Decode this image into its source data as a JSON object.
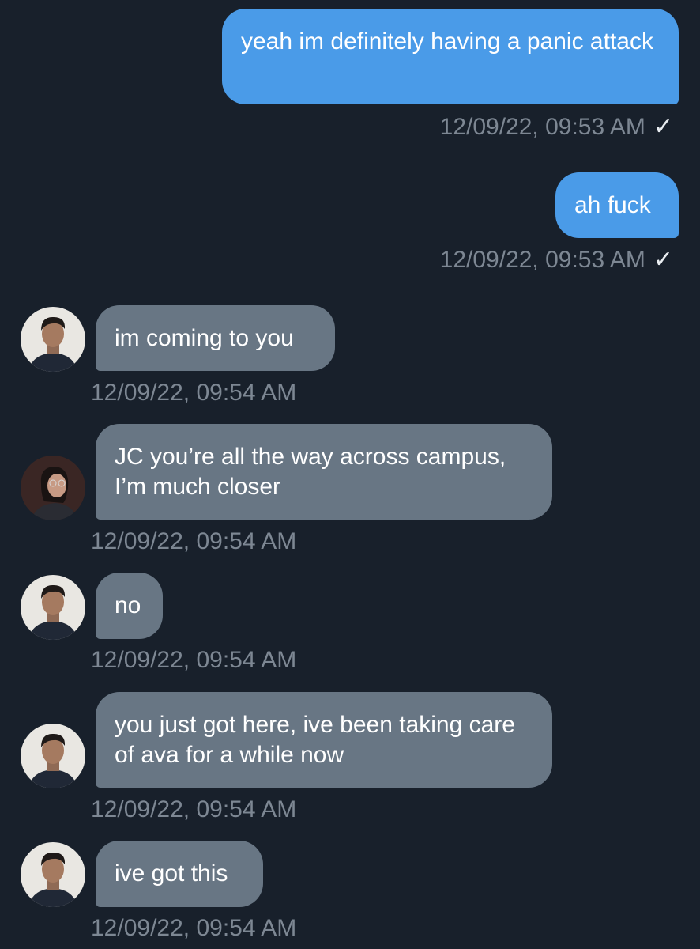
{
  "chat": {
    "messages": [
      {
        "direction": "out",
        "text": "yeah im definitely having a panic attack",
        "timestamp": "12/09/22, 09:53 AM",
        "status": "check-icon"
      },
      {
        "direction": "out",
        "text": "ah fuck",
        "timestamp": "12/09/22, 09:53 AM",
        "status": "check-icon"
      },
      {
        "direction": "in",
        "avatar": "male-avatar",
        "text": "im coming to you",
        "timestamp": "12/09/22, 09:54 AM"
      },
      {
        "direction": "in",
        "avatar": "female-avatar",
        "text": "JC you’re all the way across campus, I’m much closer",
        "timestamp": "12/09/22, 09:54 AM"
      },
      {
        "direction": "in",
        "avatar": "male-avatar",
        "text": "no",
        "timestamp": "12/09/22, 09:54 AM"
      },
      {
        "direction": "in",
        "avatar": "male-avatar",
        "text": "you just got here, ive been taking care of ava for a while now",
        "timestamp": "12/09/22, 09:54 AM"
      },
      {
        "direction": "in",
        "avatar": "male-avatar",
        "text": "ive got this",
        "timestamp": "12/09/22, 09:54 AM"
      }
    ]
  },
  "colors": {
    "background": "#18202b",
    "outgoing_bubble": "#4a9be8",
    "incoming_bubble": "#687684",
    "timestamp": "#7d8793"
  }
}
